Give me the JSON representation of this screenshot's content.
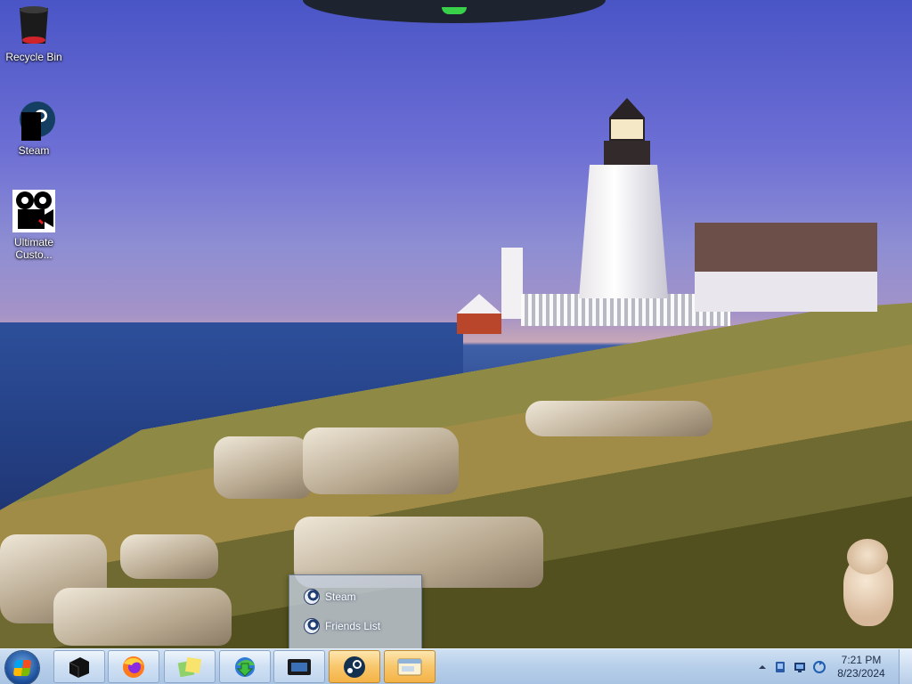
{
  "desktop_icons": [
    {
      "label": "Recycle Bin",
      "icon": "recycle-bin-icon"
    },
    {
      "label": "Steam",
      "icon": "steam-icon"
    },
    {
      "label": "Ultimate Custo...",
      "icon": "ultimate-custom-icon"
    }
  ],
  "jumplist": {
    "items": [
      {
        "label": "Steam",
        "icon": "steam-icon"
      },
      {
        "label": "Friends List",
        "icon": "steam-icon"
      }
    ]
  },
  "taskbar": {
    "start_icon": "windows-start-icon",
    "apps": [
      {
        "icon": "black-box-icon",
        "active": false
      },
      {
        "icon": "firefox-icon",
        "active": false
      },
      {
        "icon": "sticky-notes-icon",
        "active": false
      },
      {
        "icon": "internet-download-manager-icon",
        "active": false
      },
      {
        "icon": "screen-capture-icon",
        "active": false
      },
      {
        "icon": "steam-icon",
        "active": true
      },
      {
        "icon": "window-preview-icon",
        "active": true
      }
    ]
  },
  "tray": {
    "time": "7:21 PM",
    "date": "8/23/2024",
    "icons": [
      "show-hidden-icons-arrow",
      "device-icon",
      "network-icon",
      "sync-icon"
    ]
  },
  "colors": {
    "taskbar": "#b6cee9",
    "active_button": "#f8c66b",
    "sky": "#6d6fd4"
  }
}
